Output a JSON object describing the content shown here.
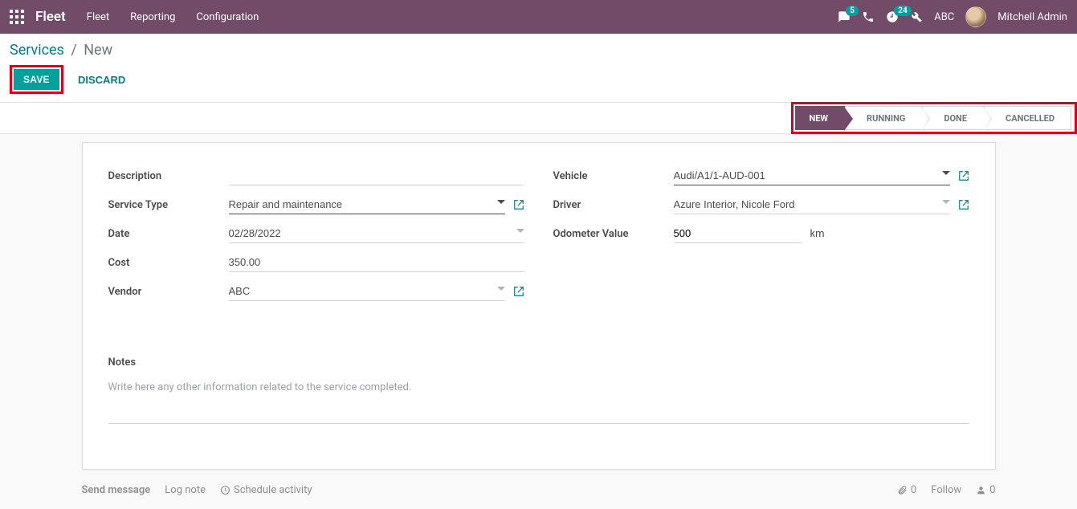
{
  "topbar": {
    "brand": "Fleet",
    "menu": [
      "Fleet",
      "Reporting",
      "Configuration"
    ],
    "messages_count": "5",
    "activities_count": "24",
    "company": "ABC",
    "user": "Mitchell Admin"
  },
  "breadcrumb": {
    "root": "Services",
    "current": "New"
  },
  "buttons": {
    "save": "SAVE",
    "discard": "DISCARD"
  },
  "status": {
    "steps": [
      "NEW",
      "RUNNING",
      "DONE",
      "CANCELLED"
    ],
    "active": "NEW"
  },
  "form": {
    "left": {
      "description_label": "Description",
      "description_value": "",
      "service_type_label": "Service Type",
      "service_type_value": "Repair and maintenance",
      "date_label": "Date",
      "date_value": "02/28/2022",
      "cost_label": "Cost",
      "cost_value": "350.00",
      "vendor_label": "Vendor",
      "vendor_value": "ABC"
    },
    "right": {
      "vehicle_label": "Vehicle",
      "vehicle_value": "Audi/A1/1-AUD-001",
      "driver_label": "Driver",
      "driver_value": "Azure Interior, Nicole Ford",
      "odometer_label": "Odometer Value",
      "odometer_value": "500",
      "odometer_unit": "km"
    },
    "notes_heading": "Notes",
    "notes_placeholder": "Write here any other information related to the service completed."
  },
  "chatter": {
    "send": "Send message",
    "log": "Log note",
    "schedule": "Schedule activity",
    "attachments": "0",
    "follow": "Follow",
    "followers": "0"
  }
}
